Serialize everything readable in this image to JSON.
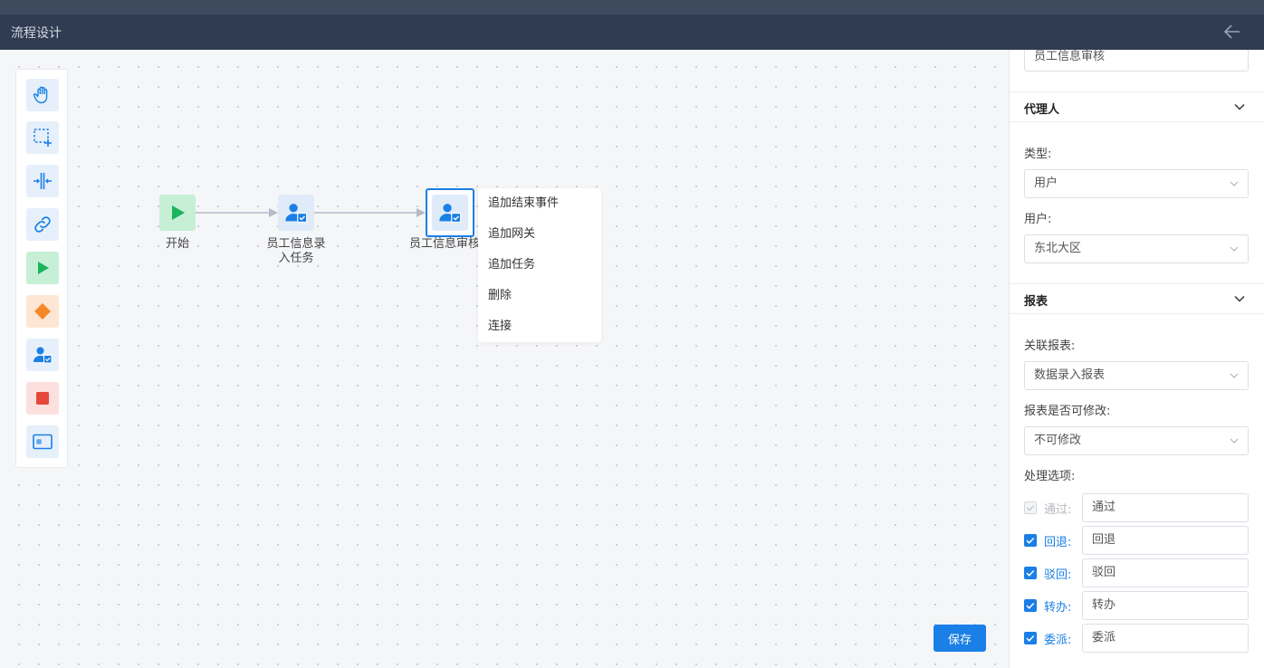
{
  "header": {
    "title": "流程设计",
    "back_icon": "arrow-left-icon"
  },
  "palette": {
    "tools": [
      {
        "name": "hand-tool",
        "icon": "hand-icon"
      },
      {
        "name": "lasso-tool",
        "icon": "lasso-icon"
      },
      {
        "name": "space-tool",
        "icon": "space-icon"
      },
      {
        "name": "connect-tool",
        "icon": "link-icon"
      },
      {
        "name": "start-event",
        "icon": "play-icon"
      },
      {
        "name": "gateway",
        "icon": "diamond-icon"
      },
      {
        "name": "user-task",
        "icon": "user-task-icon"
      },
      {
        "name": "end-event",
        "icon": "stop-icon"
      },
      {
        "name": "subprocess",
        "icon": "subprocess-icon"
      }
    ]
  },
  "diagram": {
    "nodes": [
      {
        "id": "start",
        "label": "开始"
      },
      {
        "id": "task1",
        "label_line1": "员工信息录",
        "label_line2": "入任务"
      },
      {
        "id": "task2",
        "label": "员工信息审核"
      }
    ]
  },
  "context_menu": {
    "items": [
      "追加结束事件",
      "追加网关",
      "追加任务",
      "删除",
      "连接"
    ]
  },
  "save_label": "保存",
  "panel": {
    "name_value": "员工信息审核",
    "assignee": {
      "title": "代理人",
      "type_label": "类型:",
      "type_value": "用户",
      "user_label": "用户:",
      "user_value": "东北大区"
    },
    "report": {
      "title": "报表",
      "related_label": "关联报表:",
      "related_value": "数据录入报表",
      "editable_label": "报表是否可修改:",
      "editable_value": "不可修改",
      "options_label": "处理选项:",
      "options": [
        {
          "label": "通过:",
          "value": "通过",
          "checked": true,
          "disabled": true
        },
        {
          "label": "回退:",
          "value": "回退",
          "checked": true,
          "disabled": false
        },
        {
          "label": "驳回:",
          "value": "驳回",
          "checked": true,
          "disabled": false
        },
        {
          "label": "转办:",
          "value": "转办",
          "checked": true,
          "disabled": false
        },
        {
          "label": "委派:",
          "value": "委派",
          "checked": true,
          "disabled": false
        }
      ]
    }
  },
  "colors": {
    "accent": "#1a7fe6",
    "header": "#2f3c52",
    "start_green": "#19b45c",
    "gateway_orange": "#f5882a",
    "end_red": "#e5483a"
  }
}
